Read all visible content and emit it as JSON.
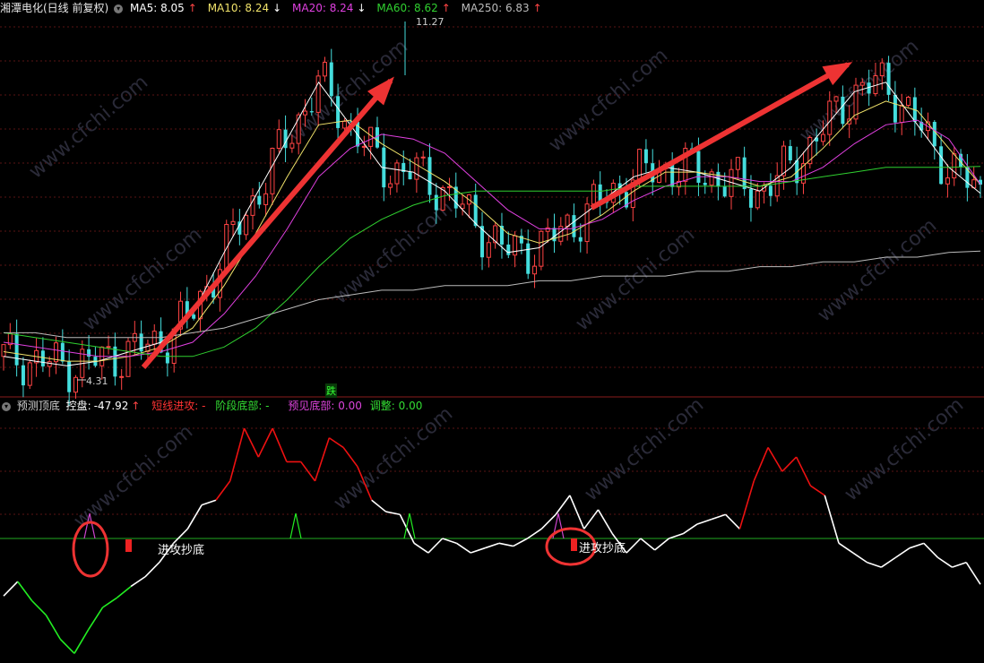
{
  "header": {
    "stock": "湘潭电化(日线 前复权)",
    "ma5": {
      "label": "MA5: 8.05",
      "arrow": "↑",
      "color": "#ffffff"
    },
    "ma10": {
      "label": "MA10: 8.24",
      "arrow": "↓",
      "color": "#f0e26a"
    },
    "ma20": {
      "label": "MA20: 8.24",
      "arrow": "↓",
      "color": "#e040e0"
    },
    "ma60": {
      "label": "MA60: 8.62",
      "arrow": "↑",
      "color": "#30d030"
    },
    "ma250": {
      "label": "MA250: 6.83",
      "arrow": "↑",
      "color": "#bbbbbb"
    }
  },
  "price_labels": {
    "high": "11.27",
    "low": "4.31",
    "signal": "跌"
  },
  "indicator_header": {
    "name": "预测顶底",
    "control_label": "控盘:",
    "control_value": "-47.92",
    "control_arrow": "↑",
    "short_attack": "短线进攻: -",
    "stage_bottom": "阶段底部: -",
    "predict_bottom": "预见底部: 0.00",
    "adjust": "调整: 0.00"
  },
  "annotations": {
    "attack_1": "进攻抄底",
    "attack_2": "进攻抄底"
  },
  "watermark": "www.cfchi.com",
  "colors": {
    "up": "#ff4444",
    "down": "#44dddd",
    "grid": "#5a1414",
    "zero": "#22aa22",
    "arrow": "#ee3333",
    "osc_red": "#ee1111",
    "osc_green": "#22ee22",
    "osc_white": "#ffffff"
  },
  "chart_data": [
    {
      "type": "line",
      "title": "湘潭电化(日线 前复权)",
      "series": [
        {
          "name": "MA5",
          "values": [
            4.6,
            4.5,
            4.4,
            4.5,
            4.7,
            4.9,
            5.5,
            6.8,
            8.0,
            9.2,
            10.4,
            9.5,
            8.6,
            8.5,
            8.1,
            7.4,
            6.8,
            6.9,
            7.4,
            7.9,
            8.4,
            8.6,
            8.5,
            8.3,
            8.1,
            8.6,
            9.4,
            10.2,
            10.4,
            9.5,
            8.6,
            8.05
          ]
        },
        {
          "name": "MA10",
          "values": [
            4.7,
            4.6,
            4.5,
            4.5,
            4.6,
            4.8,
            5.2,
            6.1,
            7.2,
            8.4,
            9.5,
            9.6,
            9.1,
            8.7,
            8.3,
            7.8,
            7.2,
            7.0,
            7.2,
            7.6,
            8.1,
            8.5,
            8.5,
            8.4,
            8.2,
            8.4,
            9.0,
            9.7,
            10.0,
            9.8,
            9.0,
            8.24
          ]
        },
        {
          "name": "MA20",
          "values": [
            4.9,
            4.8,
            4.7,
            4.6,
            4.6,
            4.7,
            4.9,
            5.5,
            6.3,
            7.3,
            8.4,
            9.0,
            9.3,
            9.2,
            8.9,
            8.3,
            7.7,
            7.3,
            7.3,
            7.5,
            7.9,
            8.2,
            8.4,
            8.4,
            8.3,
            8.3,
            8.6,
            9.1,
            9.5,
            9.6,
            9.2,
            8.24
          ]
        },
        {
          "name": "MA60",
          "values": [
            5.1,
            5.0,
            4.9,
            4.8,
            4.7,
            4.6,
            4.6,
            4.8,
            5.2,
            5.8,
            6.5,
            7.1,
            7.5,
            7.8,
            8.0,
            8.1,
            8.1,
            8.1,
            8.1,
            8.1,
            8.2,
            8.2,
            8.2,
            8.2,
            8.2,
            8.3,
            8.4,
            8.5,
            8.6,
            8.6,
            8.6,
            8.62
          ]
        },
        {
          "name": "MA250",
          "values": [
            5.1,
            5.1,
            5.0,
            5.0,
            5.0,
            5.0,
            5.1,
            5.2,
            5.4,
            5.6,
            5.8,
            5.9,
            6.0,
            6.0,
            6.1,
            6.1,
            6.1,
            6.2,
            6.2,
            6.3,
            6.3,
            6.3,
            6.4,
            6.4,
            6.5,
            6.5,
            6.6,
            6.6,
            6.7,
            6.7,
            6.8,
            6.83
          ]
        }
      ],
      "price_ylim": [
        3.8,
        11.8
      ]
    },
    {
      "type": "line",
      "title": "预测顶底",
      "series": [
        {
          "name": "控盘",
          "values": [
            -60,
            -45,
            -65,
            -80,
            -105,
            -120,
            -95,
            -72,
            -62,
            -50,
            -40,
            -25,
            -5,
            10,
            35,
            40,
            60,
            115,
            85,
            115,
            80,
            80,
            60,
            105,
            95,
            75,
            40,
            28,
            25,
            -5,
            -15,
            0,
            -5,
            -15,
            -10,
            -5,
            -8,
            0,
            10,
            25,
            45,
            10,
            30,
            5,
            -15,
            0,
            -12,
            0,
            5,
            15,
            20,
            25,
            10,
            60,
            95,
            70,
            85,
            55,
            45,
            -5,
            -15,
            -25,
            -30,
            -20,
            -10,
            -5,
            -20,
            -30,
            -25,
            -47.92
          ]
        }
      ],
      "ylim": [
        -130,
        130
      ]
    }
  ]
}
